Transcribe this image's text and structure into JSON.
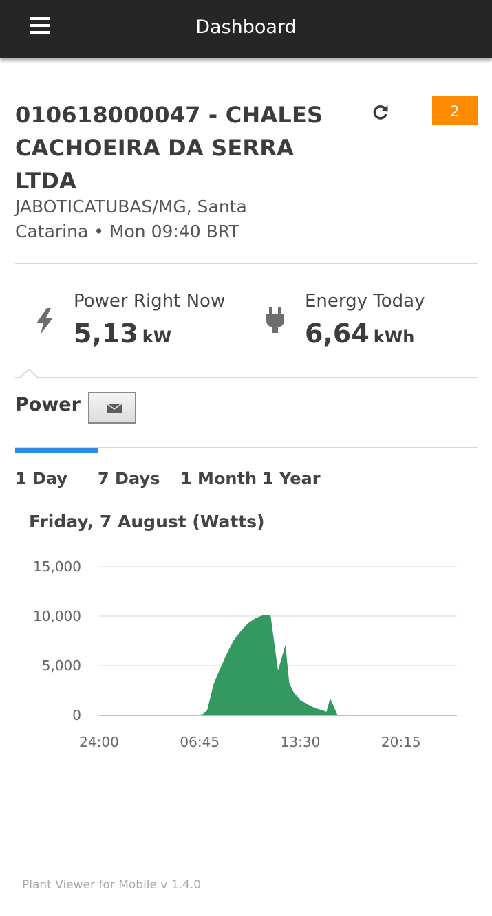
{
  "header": {
    "title": "Dashboard",
    "menu_icon": "hamburger-menu-icon"
  },
  "plant": {
    "title": "010618000047 - CHALES CACHOEIRA DA SERRA LTDA",
    "location_line": "JABOTICATUBAS/MG, Santa Catarina • Mon 09:40 BRT",
    "alert_count": "2",
    "refresh_icon": "refresh-icon"
  },
  "kpis": {
    "power": {
      "label": "Power Right Now",
      "value": "5,13",
      "unit": "kW",
      "icon": "lightning-bolt-icon"
    },
    "energy": {
      "label": "Energy Today",
      "value": "6,64",
      "unit": "kWh",
      "icon": "plug-icon"
    }
  },
  "section": {
    "title": "Power",
    "mail_icon": "envelope-icon"
  },
  "tabs": [
    {
      "label": "1 Day",
      "active": true
    },
    {
      "label": "7 Days",
      "active": false
    },
    {
      "label": "1 Month",
      "active": false
    },
    {
      "label": "1 Year",
      "active": false
    }
  ],
  "colors": {
    "topbar": "#262626",
    "accent": "#2b8ce8",
    "badge": "#ff8c00",
    "series": "#339960"
  },
  "chart_data": {
    "type": "area",
    "title": "Friday, 7 August (Watts)",
    "x_ticks": [
      "24:00",
      "06:45",
      "13:30",
      "20:15"
    ],
    "y_ticks": [
      "15,000",
      "10,000",
      "5,000",
      "0"
    ],
    "ylim": [
      0,
      15000
    ],
    "xlim_hours": [
      0,
      24
    ],
    "grid": true,
    "x": [
      0,
      6.67,
      7.0,
      7.25,
      7.67,
      8.0,
      8.5,
      9.0,
      9.5,
      10.0,
      10.5,
      11.0,
      11.5,
      12.0,
      12.5,
      12.75,
      12.95,
      13.1,
      13.3,
      13.5,
      14.0,
      14.5,
      15.0,
      15.25,
      15.5,
      16.0,
      16.5,
      16.75,
      17.0,
      17.25,
      17.5,
      17.67,
      24
    ],
    "y": [
      0,
      0,
      150,
      500,
      3100,
      4300,
      6000,
      7500,
      8500,
      9300,
      9800,
      10100,
      10100,
      4500,
      7100,
      3300,
      2600,
      2200,
      1900,
      1500,
      1100,
      700,
      500,
      350,
      1700,
      0,
      0,
      0,
      0,
      0,
      0,
      0,
      0
    ]
  },
  "footer": {
    "text": "Plant Viewer for Mobile v 1.4.0"
  }
}
